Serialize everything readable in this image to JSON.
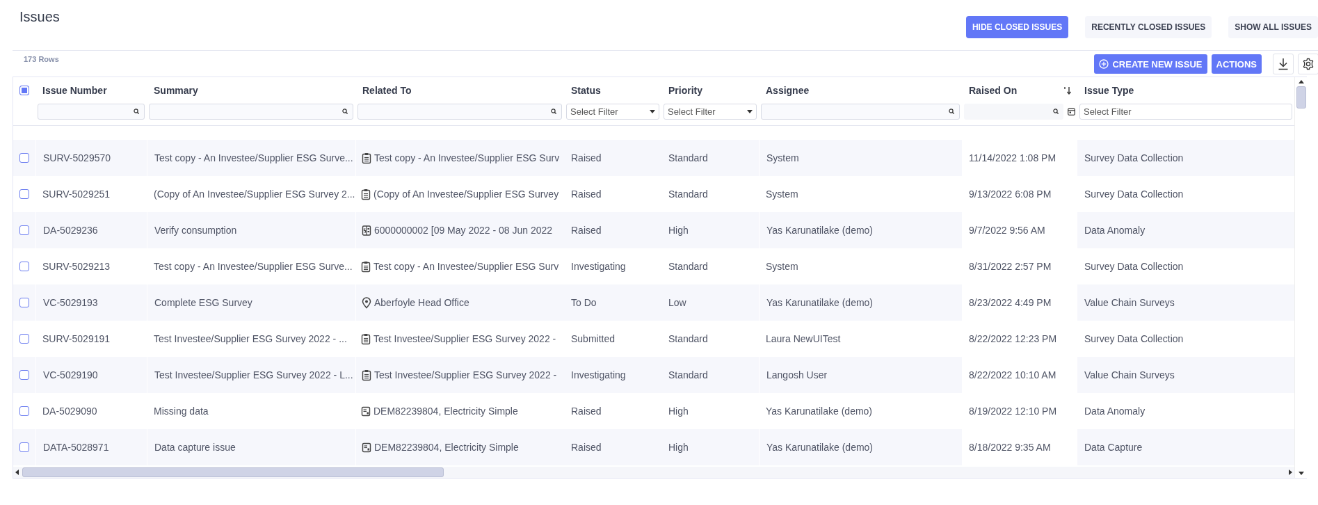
{
  "title": "Issues",
  "view_buttons": [
    {
      "label": "HIDE CLOSED ISSUES",
      "selected": true
    },
    {
      "label": "RECENTLY CLOSED ISSUES",
      "selected": false
    },
    {
      "label": "SHOW ALL ISSUES",
      "selected": false
    }
  ],
  "row_count": "173 Rows",
  "toolbar": {
    "create_button": "CREATE NEW ISSUE",
    "actions_button": "ACTIONS"
  },
  "table": {
    "select_all_checked": true,
    "columns": [
      {
        "label": "Issue Number",
        "kind": "text"
      },
      {
        "label": "Summary",
        "kind": "text"
      },
      {
        "label": "Related To",
        "kind": "text"
      },
      {
        "label": "Status",
        "kind": "select",
        "placeholder": "Select Filter"
      },
      {
        "label": "Priority",
        "kind": "select",
        "placeholder": "Select Filter"
      },
      {
        "label": "Assignee",
        "kind": "text"
      },
      {
        "label": "Raised On",
        "kind": "date",
        "sorted": true
      },
      {
        "label": "Issue Type",
        "kind": "plain",
        "placeholder": "Select Filter"
      }
    ],
    "rows": [
      {
        "selected": false,
        "issue_number": "SURV-5029570",
        "summary": "Test copy - An Investee/Supplier ESG Surve...",
        "kind": "survey",
        "related_to": "Test copy - An Investee/Supplier ESG Surv",
        "status": "Raised",
        "priority": "Standard",
        "assignee": "System",
        "raised_on": "11/14/2022 1:08 PM",
        "issue_type": "Survey Data Collection"
      },
      {
        "selected": false,
        "issue_number": "SURV-5029251",
        "summary": "(Copy of An Investee/Supplier ESG Survey 2...",
        "kind": "survey",
        "related_to": "(Copy of An Investee/Supplier ESG Survey",
        "status": "Raised",
        "priority": "Standard",
        "assignee": "System",
        "raised_on": "9/13/2022 6:08 PM",
        "issue_type": "Survey Data Collection"
      },
      {
        "selected": false,
        "issue_number": "DA-5029236",
        "summary": "Verify consumption",
        "kind": "bill",
        "related_to": "6000000002 [09 May 2022 - 08 Jun 2022",
        "status": "Raised",
        "priority": "High",
        "assignee": "Yas Karunatilake (demo)",
        "raised_on": "9/7/2022 9:56 AM",
        "issue_type": "Data Anomaly"
      },
      {
        "selected": false,
        "issue_number": "SURV-5029213",
        "summary": "Test copy - An Investee/Supplier ESG Surve...",
        "kind": "survey",
        "related_to": "Test copy - An Investee/Supplier ESG Surv",
        "status": "Investigating",
        "priority": "Standard",
        "assignee": "System",
        "raised_on": "8/31/2022 2:57 PM",
        "issue_type": "Survey Data Collection"
      },
      {
        "selected": false,
        "issue_number": "VC-5029193",
        "summary": "Complete ESG Survey",
        "kind": "location",
        "related_to": "Aberfoyle Head Office",
        "status": "To Do",
        "priority": "Low",
        "assignee": "Yas Karunatilake (demo)",
        "raised_on": "8/23/2022 4:49 PM",
        "issue_type": "Value Chain Surveys"
      },
      {
        "selected": false,
        "issue_number": "SURV-5029191",
        "summary": "Test Investee/Supplier ESG Survey 2022 - ...",
        "kind": "survey",
        "related_to": "Test Investee/Supplier ESG Survey 2022 -",
        "status": "Submitted",
        "priority": "Standard",
        "assignee": "Laura NewUITest",
        "raised_on": "8/22/2022 12:23 PM",
        "issue_type": "Survey Data Collection"
      },
      {
        "selected": false,
        "issue_number": "VC-5029190",
        "summary": "Test Investee/Supplier ESG Survey 2022 - L...",
        "kind": "survey",
        "related_to": "Test Investee/Supplier ESG Survey 2022 -",
        "status": "Investigating",
        "priority": "Standard",
        "assignee": "Langosh User",
        "raised_on": "8/22/2022 10:10 AM",
        "issue_type": "Value Chain Surveys"
      },
      {
        "selected": false,
        "issue_number": "DA-5029090",
        "summary": "Missing data",
        "kind": "meter",
        "related_to": "DEM82239804, Electricity Simple",
        "status": "Raised",
        "priority": "High",
        "assignee": "Yas Karunatilake (demo)",
        "raised_on": "8/19/2022 12:10 PM",
        "issue_type": "Data Anomaly"
      },
      {
        "selected": false,
        "issue_number": "DATA-5028971",
        "summary": "Data capture issue",
        "kind": "meter",
        "related_to": "DEM82239804, Electricity Simple",
        "status": "Raised",
        "priority": "High",
        "assignee": "Yas Karunatilake (demo)",
        "raised_on": "8/18/2022 9:35 AM",
        "issue_type": "Data Capture"
      }
    ]
  }
}
